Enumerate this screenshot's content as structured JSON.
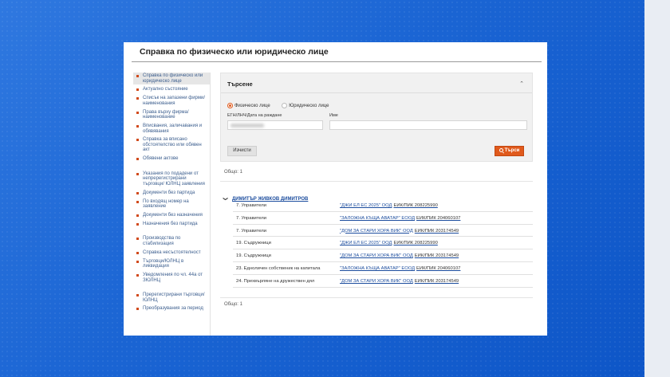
{
  "page": {
    "title": "Справка по физическо или юридическо лице"
  },
  "sidebar": {
    "groups": [
      {
        "items": [
          {
            "label": "Справка по физическо или юридическо лице",
            "active": true
          },
          {
            "label": "Актуално състояние"
          },
          {
            "label": "Списък на запазени фирми/наименования"
          },
          {
            "label": "Права върху фирма/ наименование"
          },
          {
            "label": "Вписвания, заличавания и обявявания"
          },
          {
            "label": "Справка за вписано обстоятелство или обявен акт"
          },
          {
            "label": "Обявени актове"
          }
        ]
      },
      {
        "items": [
          {
            "label": "Указания по подадени от непререгистрирани търговци/ ЮЛНЦ заявления"
          },
          {
            "label": "Документи без партида"
          },
          {
            "label": "По входящ номер на заявление"
          },
          {
            "label": "Документи без назначения"
          },
          {
            "label": "Назначения без партида"
          }
        ]
      },
      {
        "items": [
          {
            "label": "Производства по стабилизация"
          },
          {
            "label": "Справка несъстоятелност"
          },
          {
            "label": "Търговци/ЮЛНЦ в ликвидация"
          },
          {
            "label": "Уведомления по чл. 44а от ЗЮЛНЦ"
          }
        ]
      },
      {
        "items": [
          {
            "label": "Пререгистрирани търговци/ ЮЛНЦ"
          },
          {
            "label": "Преобразувания за период"
          }
        ]
      }
    ]
  },
  "search": {
    "title": "Търсене",
    "radio_person": "Физическо лице",
    "radio_legal": "Юридическо лице",
    "selected": "person",
    "label_egn": "ЕГН/ЛНЧ/Дата на раждане",
    "label_name": "Име",
    "name_value": "",
    "clear_label": "Изчисти",
    "search_label": "Търси"
  },
  "results": {
    "total_top": "Общо: 1",
    "total_bottom": "Общо: 1",
    "person_name": "ДИМИТЪР ЖИВКОВ ДИМИТРОВ",
    "rows": [
      {
        "role": "7. Управители",
        "company": "\"ДЖИ ЕЛ ЕС 2025\" ООД",
        "eik": "ЕИК/ПИК 208225990"
      },
      {
        "role": "7. Управители",
        "company": "\"ЗАЛОЖНА КЪЩА АВАТАР\" ЕООД",
        "eik": "ЕИК/ПИК 204060107"
      },
      {
        "role": "7. Управители",
        "company": "\"ДОМ ЗА СТАРИ ХОРА ВИК\" ООД",
        "eik": "ЕИК/ПИК 203174549"
      },
      {
        "role": "19. Съдружници",
        "company": "\"ДЖИ ЕЛ ЕС 2025\" ООД",
        "eik": "ЕИК/ПИК 208225990"
      },
      {
        "role": "19. Съдружници",
        "company": "\"ДОМ ЗА СТАРИ ХОРА ВИК\" ООД",
        "eik": "ЕИК/ПИК 203174549"
      },
      {
        "role": "23. Едноличен собственик на капитала",
        "company": "\"ЗАЛОЖНА КЪЩА АВАТАР\" ЕООД",
        "eik": "ЕИК/ПИК 204060107"
      },
      {
        "role": "24. Прехвърляне на дружествен дял",
        "company": "\"ДОМ ЗА СТАРИ ХОРА ВИК\" ООД",
        "eik": "ЕИК/ПИК 203174549"
      }
    ]
  }
}
